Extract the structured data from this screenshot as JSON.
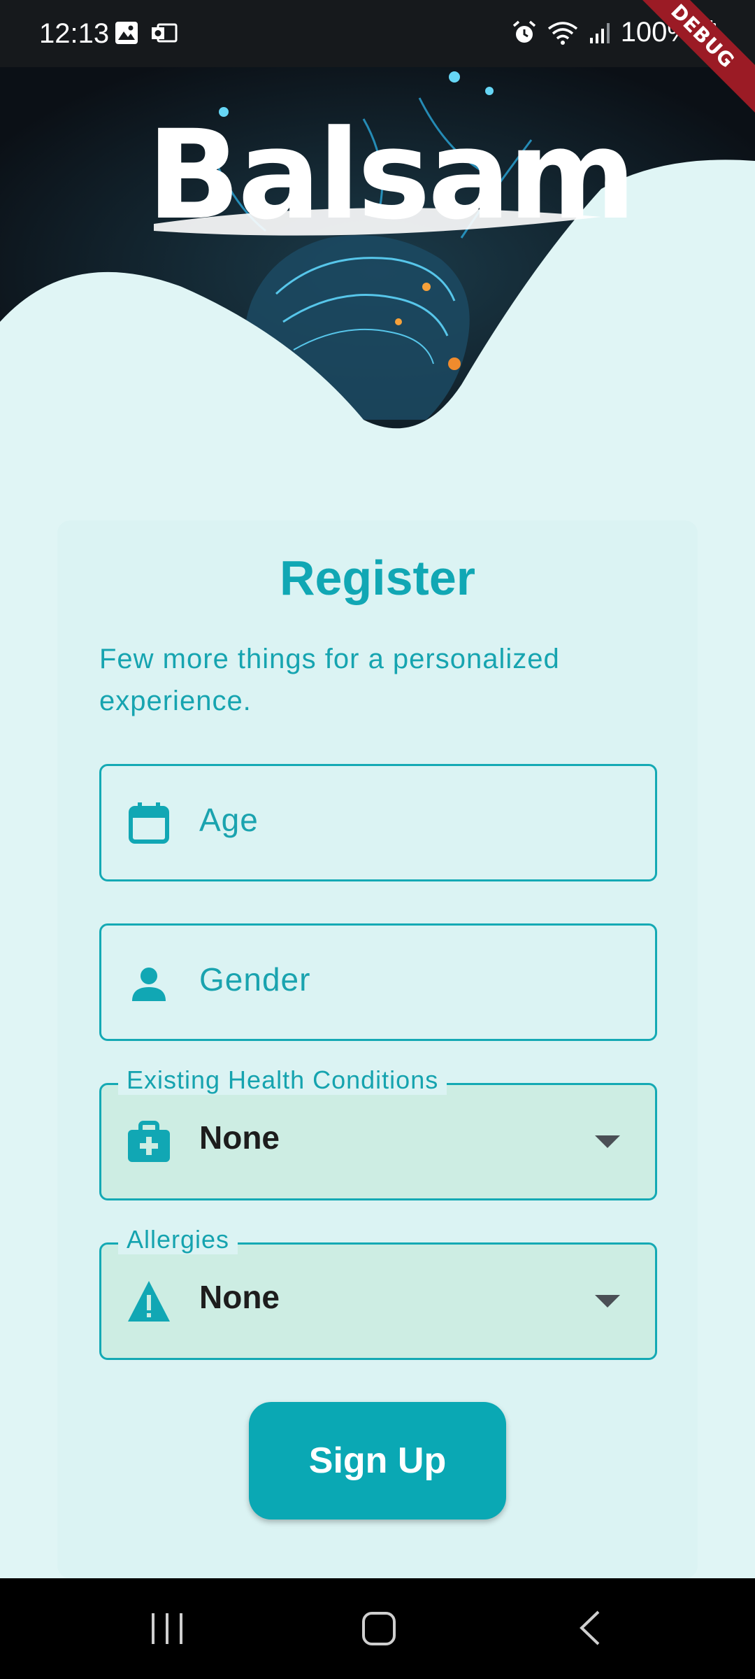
{
  "status_bar": {
    "time": "12:13",
    "battery_text": "100%",
    "left_icons": [
      "image-icon",
      "outlook-mail-icon"
    ],
    "right_icons": [
      "alarm-icon",
      "wifi-icon",
      "signal-icon",
      "battery-icon"
    ]
  },
  "debug_banner": {
    "text": "DEBUG"
  },
  "header": {
    "logo_text": "Balsam"
  },
  "form": {
    "title": "Register",
    "subtitle": "Few more things for a personalized experience.",
    "age": {
      "placeholder": "Age",
      "icon": "calendar-icon"
    },
    "gender": {
      "placeholder": "Gender",
      "icon": "person-icon"
    },
    "health_conditions": {
      "label": "Existing Health Conditions",
      "value": "None",
      "icon": "medical-bag-icon"
    },
    "allergies": {
      "label": "Allergies",
      "value": "None",
      "icon": "warning-icon"
    },
    "signup_label": "Sign Up"
  },
  "nav": {
    "buttons": [
      "recents-icon",
      "home-icon",
      "back-icon"
    ]
  },
  "colors": {
    "accent": "#11a7b4",
    "background": "#e0f5f5",
    "card": "#dbf3f3",
    "filled_field": "#cdede3",
    "debug": "#9b1b25"
  }
}
